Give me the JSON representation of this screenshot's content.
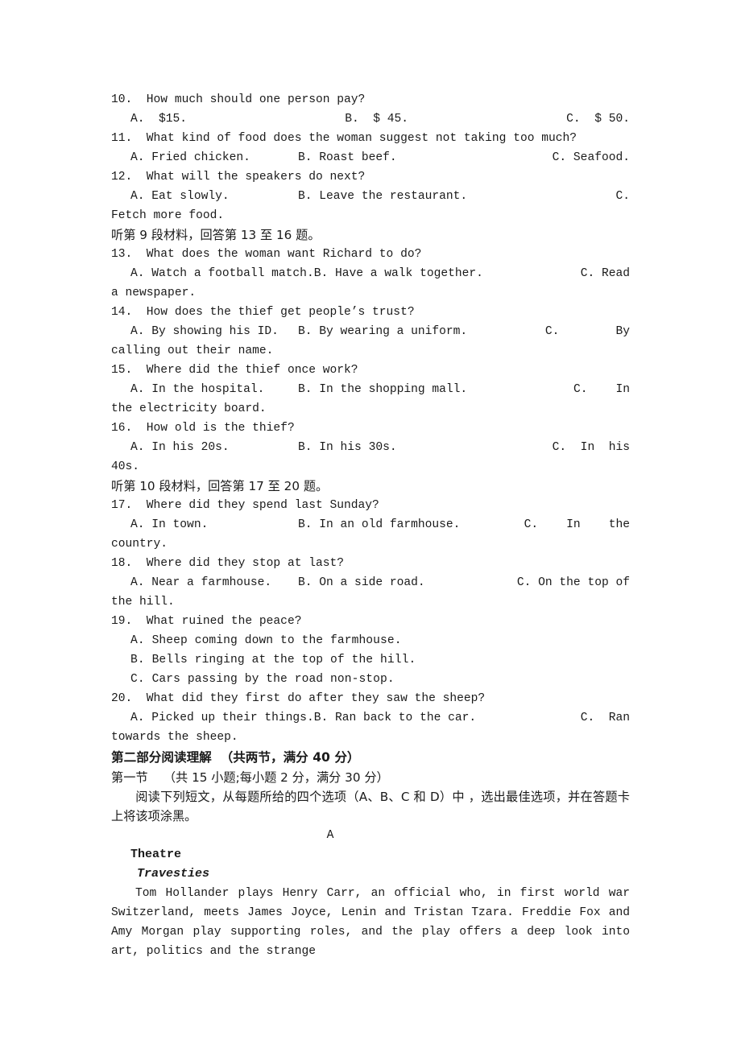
{
  "document": {
    "type": "exam-paper",
    "language": "en-zh",
    "page_bg": "#ffffff",
    "text_color": "#1a1a1a"
  },
  "listening": {
    "questions": [
      {
        "number": "10.",
        "stem": "10.  How much should one person pay?",
        "a": "A.  $15.",
        "b": "B.  $ 45.",
        "c": "C.  $ 50.",
        "cont": ""
      },
      {
        "number": "11.",
        "stem": "11.  What kind of food does the woman suggest not taking too much?",
        "a": "A. Fried chicken.",
        "b": "B. Roast beef.",
        "c": "C. Seafood.",
        "cont": ""
      },
      {
        "number": "12.",
        "stem": "12.  What will the speakers do next?",
        "a": "A. Eat slowly.",
        "b": "B. Leave the restaurant.",
        "c": "C.",
        "cont": "Fetch more food."
      }
    ],
    "prompt_9": "听第 9 段材料，回答第 13 至 16 题。",
    "questions_9": [
      {
        "number": "13.",
        "stem": "13.  What does the woman want Richard to do?",
        "a": "A. Watch a football match.",
        "b": "B. Have a walk together.",
        "c": "C. Read",
        "cont": "a newspaper."
      },
      {
        "number": "14.",
        "stem": "14.  How does the thief get people’s trust?",
        "a": "A. By showing his ID.",
        "b": "B. By wearing a uniform.",
        "c": "C.        By",
        "cont": "calling out their name."
      },
      {
        "number": "15.",
        "stem": "15.  Where did the thief once work?",
        "a": "A. In the hospital.",
        "b": "B. In the shopping mall.",
        "c": "C.    In",
        "cont": "the electricity board."
      },
      {
        "number": "16.",
        "stem": "16.  How old is the thief?",
        "a": "A. In his 20s.",
        "b": "B. In his 30s.",
        "c": "C.  In  his",
        "cont": "40s."
      }
    ],
    "prompt_10": "听第 10 段材料，回答第 17 至 20 题。",
    "questions_10": [
      {
        "number": "17.",
        "stem": "17.  Where did they spend last Sunday?",
        "a": "A. In town.",
        "b": "B. In an old farmhouse.",
        "c": "C.    In    the",
        "cont": "country."
      },
      {
        "number": "18.",
        "stem": "18.  Where did they stop at last?",
        "a": "A. Near a farmhouse.",
        "b": "B. On a side road.",
        "c": "C. On the top of",
        "cont": "the hill."
      }
    ],
    "question_19": {
      "number": "19.",
      "stem": "19.  What ruined the peace?",
      "options": [
        "A. Sheep coming down to the farmhouse.",
        "B. Bells ringing at the top of the hill.",
        "C. Cars passing by the road non-stop."
      ]
    },
    "question_20": {
      "number": "20.",
      "stem": "20.  What did they first do after they saw the sheep?",
      "a": "A. Picked up their things.",
      "b": "B. Ran back to the car.",
      "c": "C.  Ran",
      "cont": "towards the sheep."
    }
  },
  "part_two": {
    "heading": "第二部分阅读理解  （共两节，满分 40 分）",
    "section_one": "第一节    （共 15 小题;每小题 2 分，满分 30 分）",
    "instruction": "阅读下列短文，从每题所给的四个选项（A、B、C 和 D）中 ，选出最佳选项，并在答题卡上将该项涂黑。",
    "passage_label": "A",
    "passage": {
      "title": "Theatre",
      "subtitle": "Travesties",
      "body": "Tom Hollander plays Henry Carr, an official who, in first world war Switzerland, meets James Joyce, Lenin and Tristan Tzara. Freddie Fox and Amy Morgan play supporting roles, and the play offers a deep look into art, politics and the strange"
    }
  }
}
